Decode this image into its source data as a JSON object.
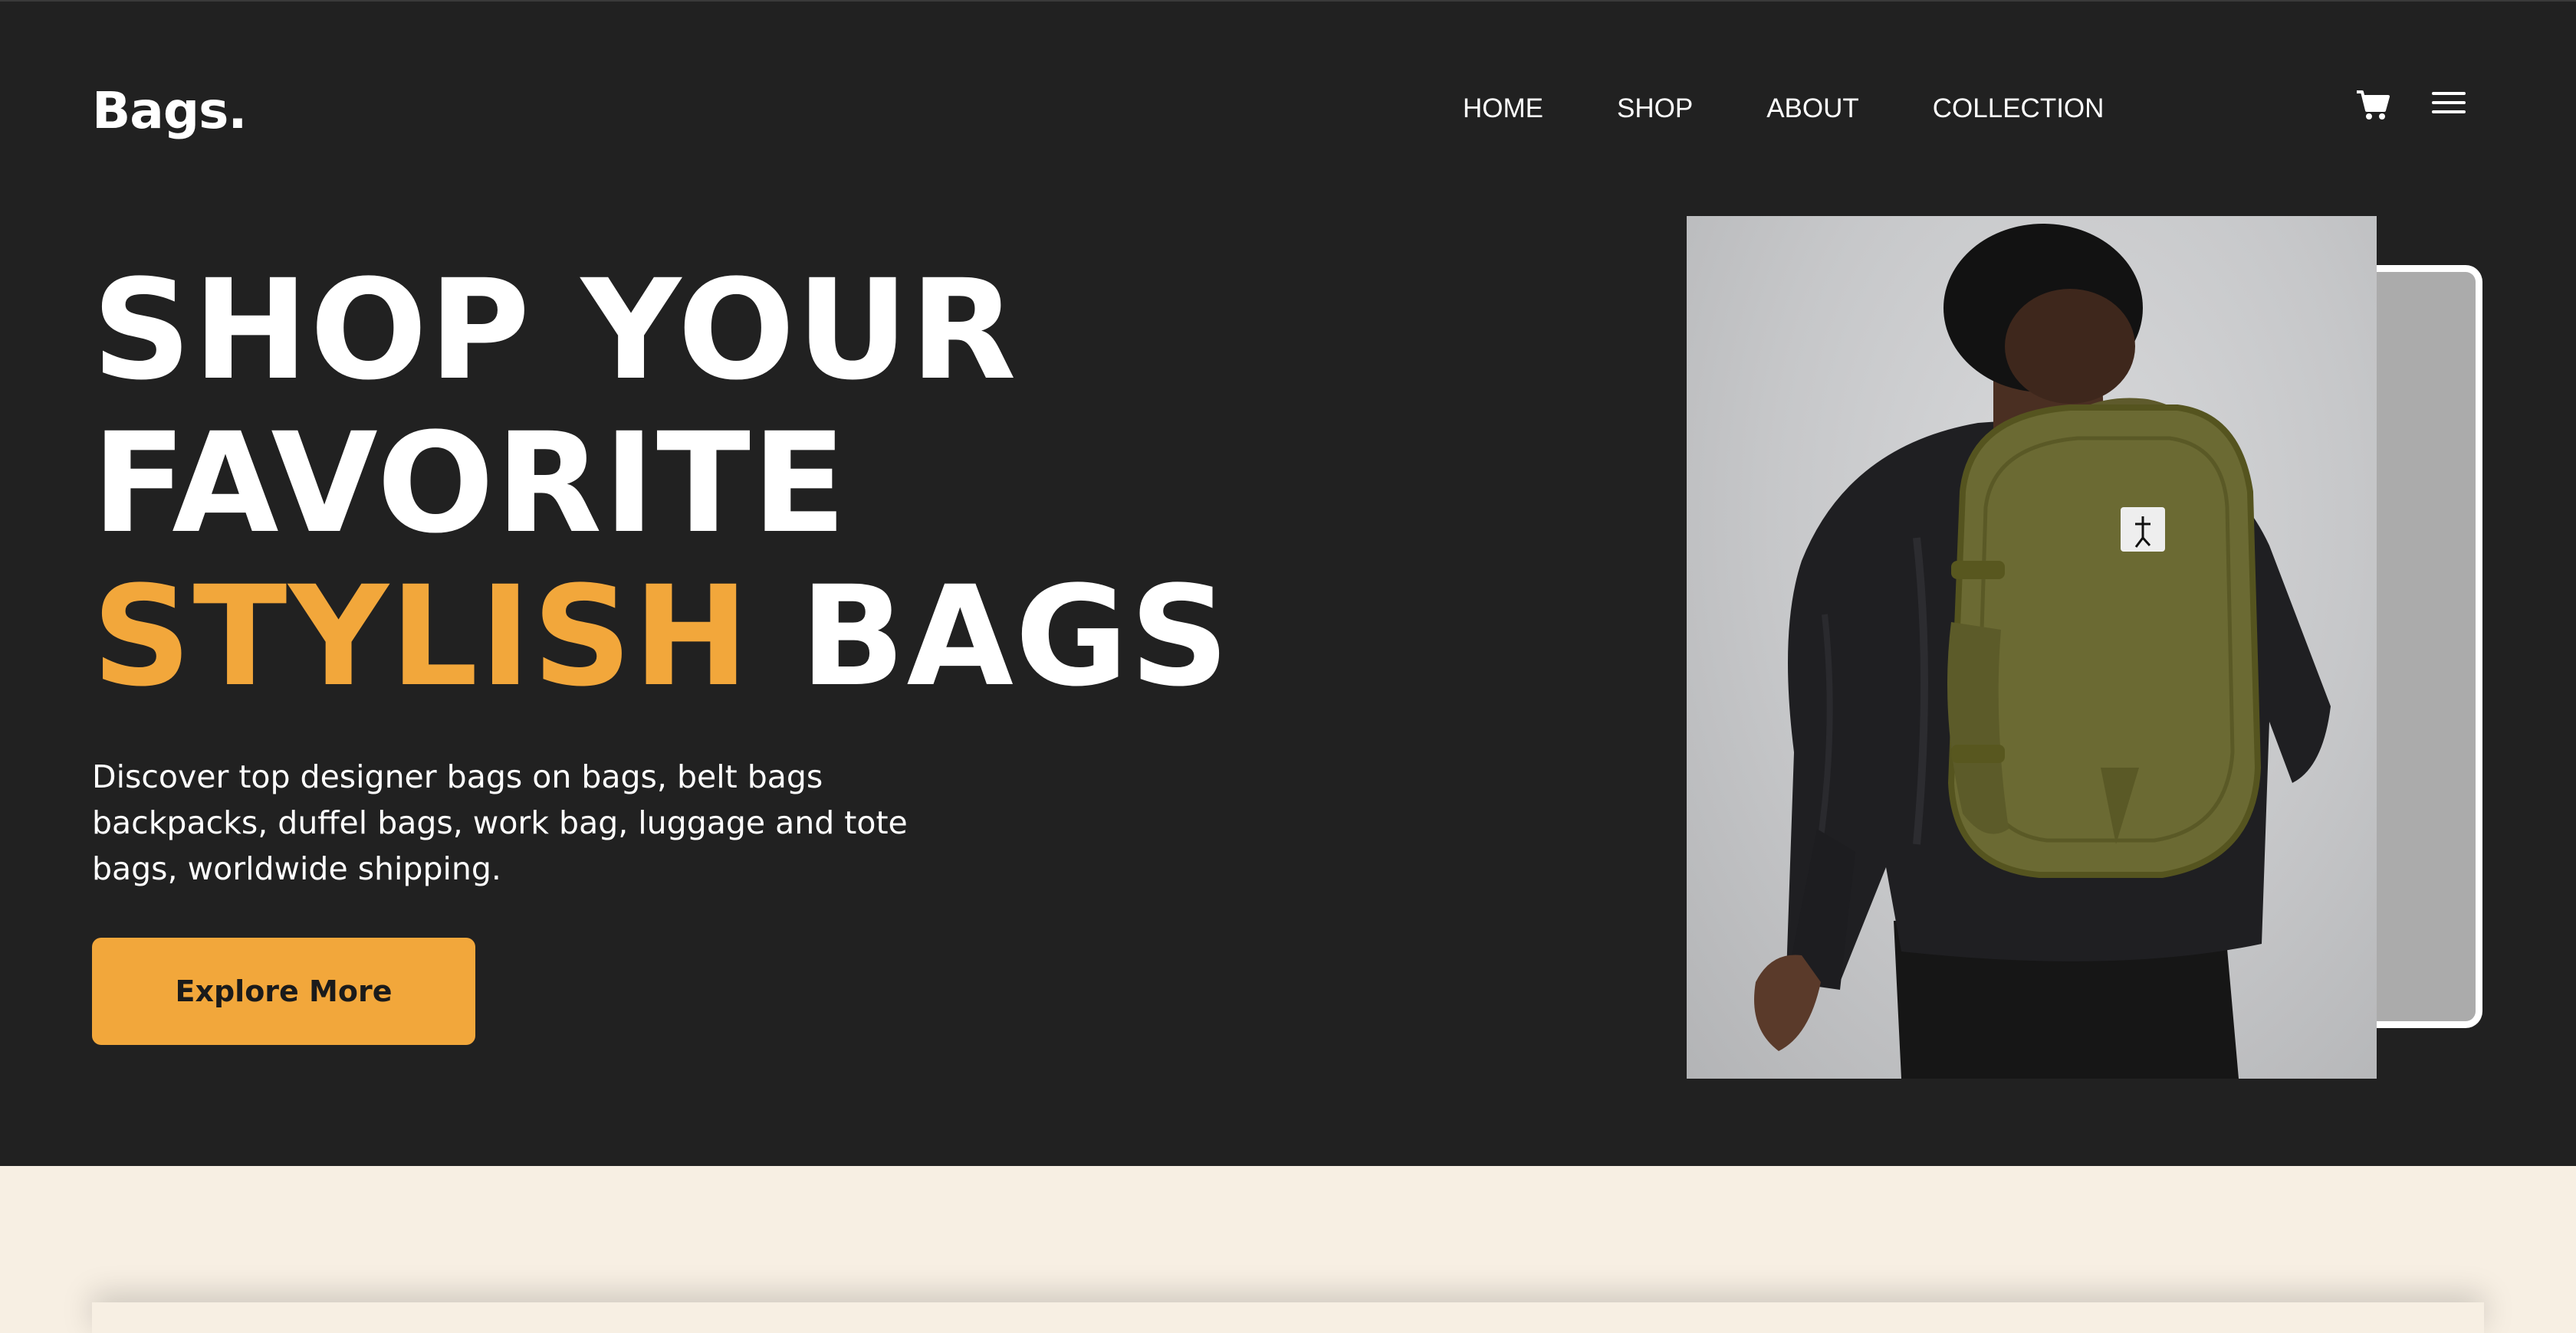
{
  "brand": {
    "logo": "Bags."
  },
  "nav": {
    "items": [
      "HOME",
      "SHOP",
      "ABOUT",
      "COLLECTION"
    ]
  },
  "icons": {
    "cart": "cart-icon",
    "menu": "hamburger-menu-icon"
  },
  "hero": {
    "line1": "SHOP YOUR",
    "line2": "FAVORITE",
    "line3_accent": "STYLISH",
    "line3_rest": "BAGS",
    "description": "Discover top designer bags on bags, belt bags backpacks, duffel bags, work bag, luggage and tote bags, worldwide shipping.",
    "cta_label": "Explore More"
  },
  "colors": {
    "background": "#212121",
    "accent": "#f2a73b",
    "text": "#ffffff",
    "section_below": "#f7efe3"
  }
}
